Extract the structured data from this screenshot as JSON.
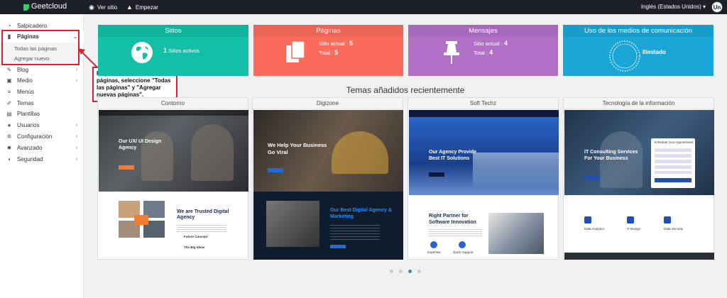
{
  "topbar": {
    "brand": "Geetcloud",
    "view_site": "Ver sitio",
    "start": "Empezar",
    "language": "Inglés (Estados Unidos)",
    "avatar": "Un"
  },
  "sidebar": {
    "items": [
      {
        "label": "Salpicadero",
        "icon": "gauge-icon"
      },
      {
        "label": "Páginas",
        "icon": "pages-icon"
      },
      {
        "label": "Blog",
        "icon": "pin-icon"
      },
      {
        "label": "Medio",
        "icon": "media-icon"
      },
      {
        "label": "Menús",
        "icon": "list-icon"
      },
      {
        "label": "Temas",
        "icon": "brush-icon"
      },
      {
        "label": "Plantillas",
        "icon": "template-icon"
      },
      {
        "label": "Usuarios",
        "icon": "users-icon"
      },
      {
        "label": "Configuración",
        "icon": "gear-icon"
      },
      {
        "label": "Avanzado",
        "icon": "cog-icon"
      },
      {
        "label": "Seguridad",
        "icon": "shield-icon"
      }
    ],
    "sub_items": [
      "Todas las páginas",
      "Agregar nuevo"
    ]
  },
  "callout": "Haga clic en la opción de páginas, seleccione \"Todas las páginas\" y \"Agregar nuevas páginas\".",
  "cards": {
    "sitios": {
      "title": "Sitios",
      "count": "1",
      "label": "Sitios activos"
    },
    "paginas": {
      "title": "Páginas",
      "current_label": "Sitio actual :",
      "current": "5",
      "total_label": "Total :",
      "total": "5"
    },
    "mensajes": {
      "title": "Mensajes",
      "current_label": "Sitio actual :",
      "current": "4",
      "total_label": "Total :",
      "total": "4"
    },
    "uso": {
      "title": "Uso de los medios de comunicación",
      "value": "Ilimitado"
    }
  },
  "themes_title": "Temas añadidos recientemente",
  "themes": [
    {
      "name": "Contorno",
      "headline": "Our UX/ UI Design Agency",
      "sub": "We are Trusted Digital Agency",
      "extra1": "Future Concept",
      "extra2": "The Big Ideas"
    },
    {
      "name": "Digizone",
      "headline": "We Help Your Business Go Viral",
      "sub": "Our Best Digital Agency & Marketing"
    },
    {
      "name": "Soft Techz",
      "headline": "Our Agency Provide Best IT Solutions",
      "sub": "Right Partner for Software Innovation",
      "extra1": "Expertise",
      "extra2": "Quick Support"
    },
    {
      "name": "Tecnología de la información",
      "headline": "IT Consulting Services For Your Business",
      "form": "Schedule Your Appointment",
      "extra1": "Data Analytics",
      "extra2": "IT Design",
      "extra3": "Data Security"
    }
  ],
  "colors": {
    "sitios": "#13bfa6",
    "paginas": "#fb6b5b",
    "mensajes": "#b16fc6",
    "uso": "#1aa6d6"
  }
}
